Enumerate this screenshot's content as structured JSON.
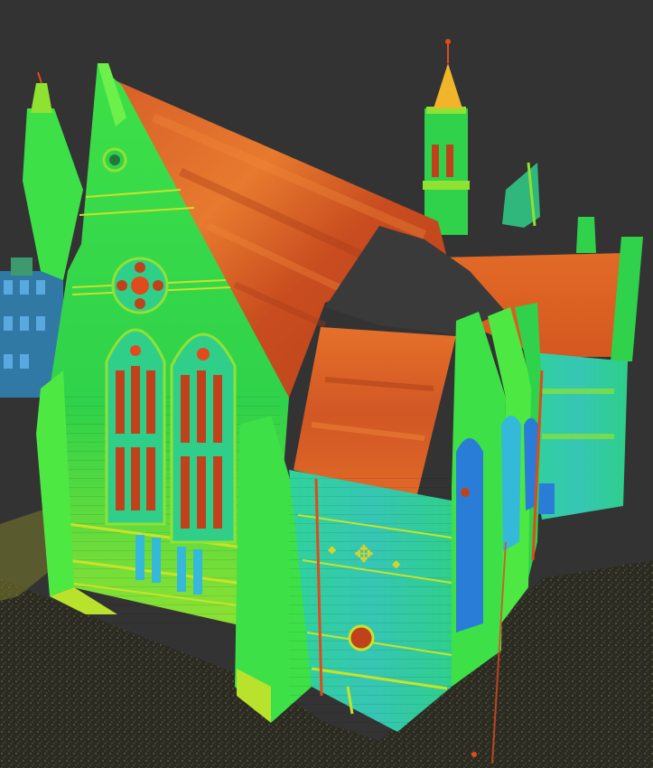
{
  "scene": {
    "subject": "point-cloud-scan",
    "colors": {
      "background": "#333333",
      "ground": "#2a2a22",
      "ground_speckle": "#6b6b3c",
      "facade_green": "#2fdc3a",
      "facade_light": "#6ef04a",
      "facade_yellow": "#c8e22a",
      "facade_teal": "#2fc9a9",
      "facade_cyan": "#34b9d8",
      "window_blue": "#2a7dd6",
      "roof_orange": "#e66a22",
      "roof_red": "#c44b1e",
      "roof_dark": "#a63a18",
      "spire_gold": "#f0b52a"
    }
  }
}
